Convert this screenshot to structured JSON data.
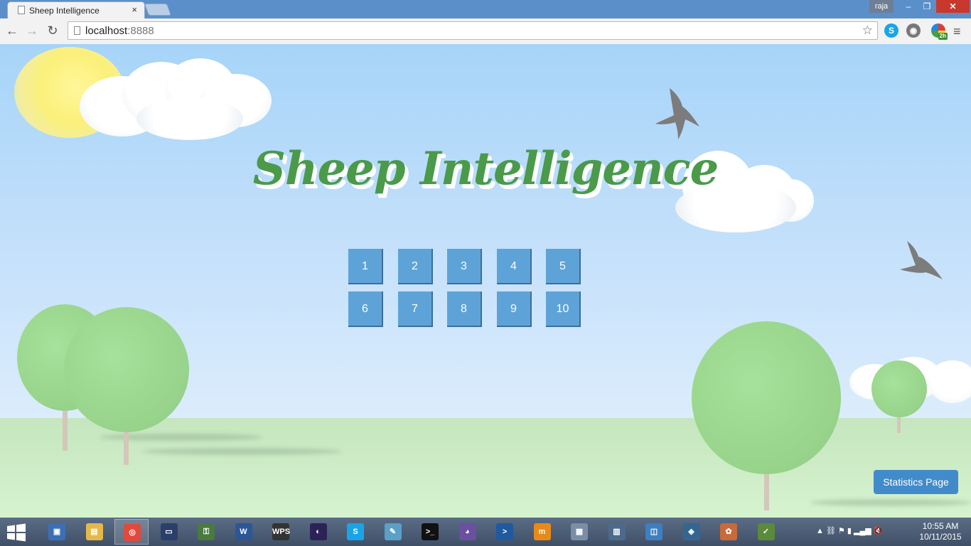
{
  "browser": {
    "tab_title": "Sheep Intelligence",
    "tab_close": "×",
    "user_name": "raja",
    "window_controls": {
      "minimize": "–",
      "maximize": "❐",
      "close": "✕"
    },
    "url_host": "localhost",
    "url_port": ":8888",
    "nav": {
      "back": "←",
      "forward": "→",
      "reload": "↻"
    },
    "bookmark_star": "☆",
    "menu": "≡",
    "extensions": [
      {
        "name": "skype",
        "icon": "S"
      },
      {
        "name": "eye",
        "icon": "◉"
      },
      {
        "name": "colorful",
        "icon": "",
        "badge": "2h"
      }
    ]
  },
  "page": {
    "title": "Sheep Intelligence",
    "levels": [
      "1",
      "2",
      "3",
      "4",
      "5",
      "6",
      "7",
      "8",
      "9",
      "10"
    ],
    "statistics_button": "Statistics Page"
  },
  "taskbar": {
    "apps": [
      {
        "name": "computer",
        "icon": "▣",
        "color": "#3d6fb6"
      },
      {
        "name": "file-explorer",
        "icon": "▤",
        "color": "#e6b84a"
      },
      {
        "name": "chrome",
        "icon": "◎",
        "color": "#e04a3c",
        "active": true
      },
      {
        "name": "cmd-folder",
        "icon": "▭",
        "color": "#2b3f6b"
      },
      {
        "name": "security",
        "icon": "⚿",
        "color": "#4a7a3f"
      },
      {
        "name": "word",
        "icon": "W",
        "color": "#2b5797"
      },
      {
        "name": "wps",
        "icon": "WPS",
        "color": "#333333"
      },
      {
        "name": "eclipse",
        "icon": "◐",
        "color": "#2c2255"
      },
      {
        "name": "skype",
        "icon": "S",
        "color": "#1aa4e8"
      },
      {
        "name": "notes",
        "icon": "✎",
        "color": "#5aa0c8"
      },
      {
        "name": "command-prompt",
        "icon": ">_",
        "color": "#111111"
      },
      {
        "name": "github",
        "icon": "◕",
        "color": "#6b4fa0"
      },
      {
        "name": "powershell",
        "icon": ">",
        "color": "#1f5aa0"
      },
      {
        "name": "mr-tool",
        "icon": "m",
        "color": "#e88a1a"
      },
      {
        "name": "monitor",
        "icon": "▦",
        "color": "#7a8ea8"
      },
      {
        "name": "calculator",
        "icon": "▥",
        "color": "#4c6a8c"
      },
      {
        "name": "control-panel",
        "icon": "◫",
        "color": "#3d7fc0"
      },
      {
        "name": "postgres",
        "icon": "◈",
        "color": "#336791"
      },
      {
        "name": "paint",
        "icon": "✿",
        "color": "#c86a3a"
      },
      {
        "name": "chart-editor",
        "icon": "✓",
        "color": "#5a8a3a"
      }
    ],
    "tray_icons": "▲  ⛓  ⚑  ▮  ▂▄▆  🔇",
    "time": "10:55 AM",
    "date": "10/11/2015"
  }
}
